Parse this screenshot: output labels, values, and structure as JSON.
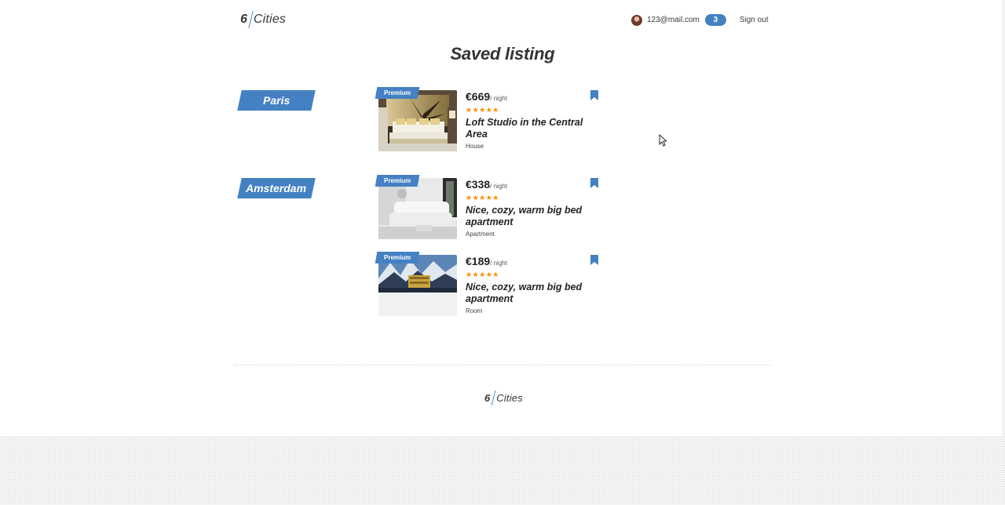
{
  "header": {
    "logo": {
      "num": "6",
      "name": "Cities"
    },
    "user_email": "123@mail.com",
    "favorites_count": "3",
    "sign_out": "Sign out"
  },
  "page_title": "Saved listing",
  "cities": [
    {
      "name": "Paris",
      "offers": [
        {
          "premium": "Premium",
          "price": "€669",
          "per_night": "/ night",
          "rating": 0.8,
          "title": "Loft Studio in the Central Area",
          "type": "House"
        }
      ]
    },
    {
      "name": "Amsterdam",
      "offers": [
        {
          "premium": "Premium",
          "price": "€338",
          "per_night": "/ night",
          "rating": 1.0,
          "title": "Nice, cozy, warm big bed apartment",
          "type": "Apartment"
        },
        {
          "premium": "Premium",
          "price": "€189",
          "per_night": "/ night",
          "rating": 0.8,
          "title": "Nice, cozy, warm big bed apartment",
          "type": "Room"
        }
      ]
    }
  ],
  "footer": {
    "logo": {
      "num": "6",
      "name": "Cities"
    }
  },
  "colors": {
    "accent": "#4481c3",
    "star": "#ff9000",
    "text": "#383838"
  },
  "icons": {
    "bookmark": "bookmark-icon",
    "avatar": "user-avatar"
  }
}
